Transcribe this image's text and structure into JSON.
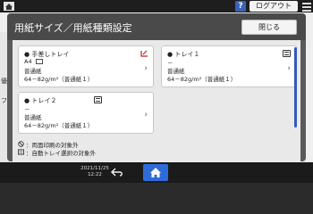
{
  "topbar": {
    "help_label": "?",
    "logout_label": "ログアウト"
  },
  "background": {
    "text1": "優",
    "text2": "フ"
  },
  "dialog": {
    "title": "用紙サイズ／用紙種類設定",
    "close_label": "閉じる"
  },
  "trays": [
    {
      "name": "● 手差しトレイ",
      "size": "A4",
      "type": "普通紙",
      "weight": "64－82g/m²（普通紙１）"
    },
    {
      "name": "● トレイ１",
      "size": "－",
      "type": "普通紙",
      "weight": "64－82g/m²（普通紙１）"
    },
    {
      "name": "● トレイ２",
      "size": "－",
      "type": "普通紙",
      "weight": "64－82g/m²（普通紙１）"
    }
  ],
  "legend": {
    "duplex_excluded": "：両面印刷の対象外",
    "auto_tray_excluded": "：自動トレイ選択の対象外"
  },
  "bottombar": {
    "date": "2021/11/25",
    "time": "12:22"
  },
  "colors": {
    "accent": "#2f6bd8",
    "scrollbar": "#3358b8"
  }
}
